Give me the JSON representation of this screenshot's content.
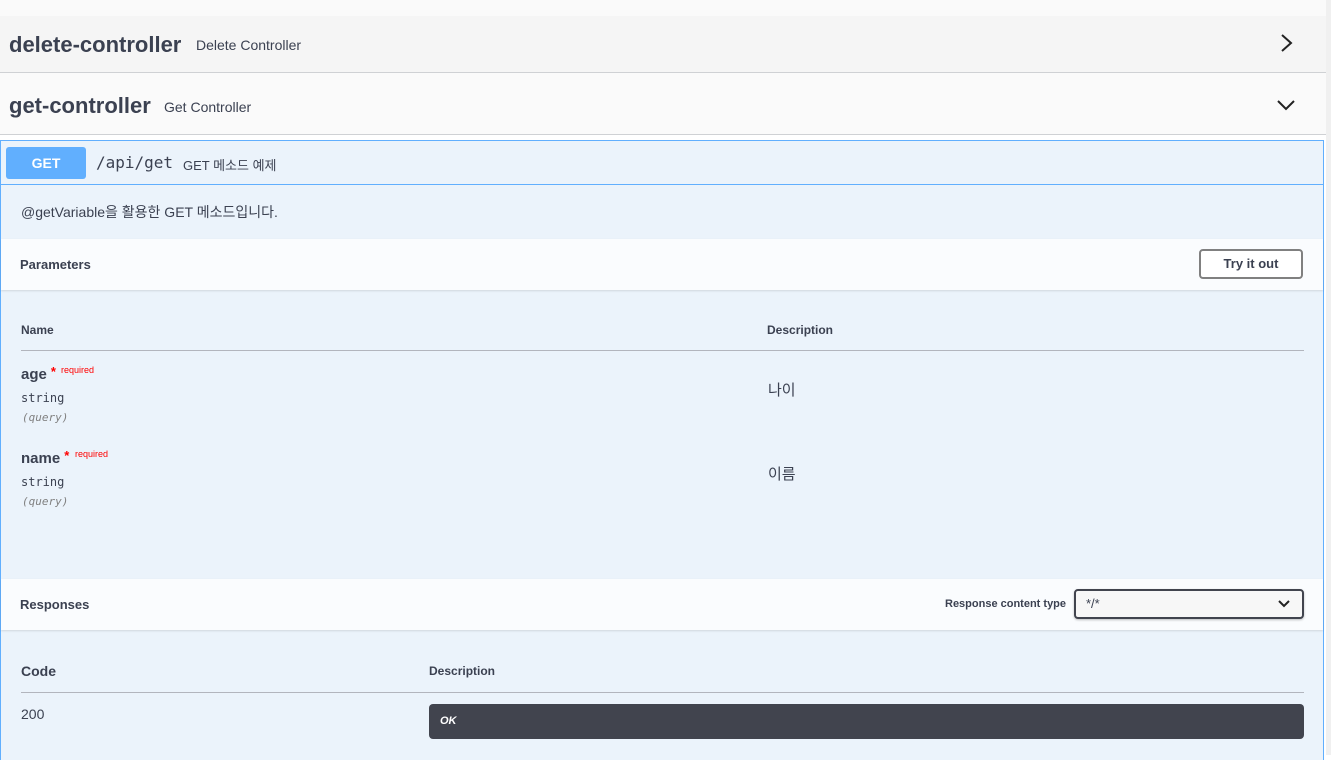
{
  "tags": [
    {
      "name": "delete-controller",
      "description": "Delete Controller",
      "expanded": false,
      "chevron_icon": "chevron-right-icon"
    },
    {
      "name": "get-controller",
      "description": "Get Controller",
      "expanded": true,
      "chevron_icon": "chevron-down-icon"
    }
  ],
  "operation": {
    "method": "GET",
    "path": "/api/get",
    "summary": "GET 메소드 예제",
    "description": "@getVariable을 활용한 GET 메소드입니다.",
    "method_color": "#61affe"
  },
  "parameters": {
    "title": "Parameters",
    "try_label": "Try it out",
    "col_name": "Name",
    "col_desc": "Description",
    "items": [
      {
        "name": "age",
        "star": "*",
        "required": "required",
        "type": "string",
        "in": "(query)",
        "description": "나이"
      },
      {
        "name": "name",
        "star": "*",
        "required": "required",
        "type": "string",
        "in": "(query)",
        "description": "이름"
      }
    ]
  },
  "responses": {
    "title": "Responses",
    "content_type_label": "Response content type",
    "content_type_value": "*/*",
    "col_code": "Code",
    "col_desc": "Description",
    "items": [
      {
        "code": "200",
        "description": "OK"
      }
    ]
  }
}
